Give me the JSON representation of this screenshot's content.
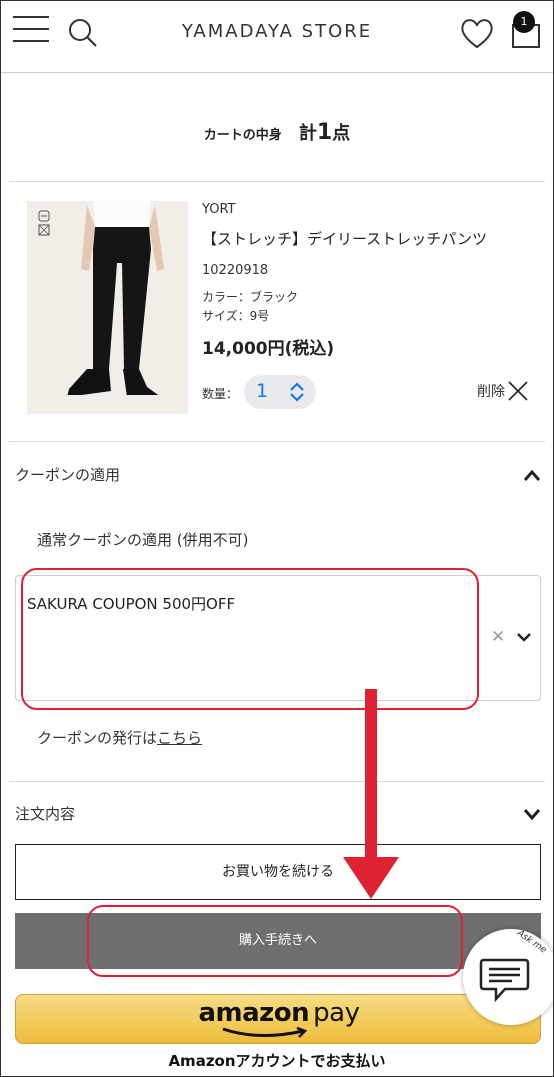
{
  "header": {
    "store_name": "YAMADAYA STORE",
    "cart_badge": "1"
  },
  "cart": {
    "label": "カートの中身",
    "total_prefix": "計",
    "total_count": "1",
    "total_suffix": "点"
  },
  "product": {
    "brand": "YORT",
    "name": "【ストレッチ】デイリーストレッチパンツ",
    "code": "10220918",
    "color": "カラー：ブラック",
    "size": "サイズ：9号",
    "price": "14,000円(税込)",
    "quantity_label": "数量：",
    "quantity_value": "1",
    "delete_label": "削除"
  },
  "coupon": {
    "section_title": "クーポンの適用",
    "sub_title": "通常クーポンの適用 (併用不可)",
    "selected_value": "SAKURA COUPON 500円OFF",
    "clear_symbol": "✕",
    "issue_text": "クーポンの発行は",
    "issue_link": "こちら"
  },
  "order": {
    "section_title": "注文内容"
  },
  "buttons": {
    "continue": "お買い物を続ける",
    "purchase": "購入手続きへ",
    "amazon_brand": "amazon",
    "amazon_pay": "pay",
    "amazon_caption": "Amazonアカウントでお支払い"
  },
  "chat": {
    "ask_me": "Ask me"
  },
  "colors": {
    "annotation_red": "#dd2233",
    "purchase_bg": "#6f6f6f",
    "amazon_gold": "#edbd3a",
    "quantity_blue": "#1479ee"
  }
}
